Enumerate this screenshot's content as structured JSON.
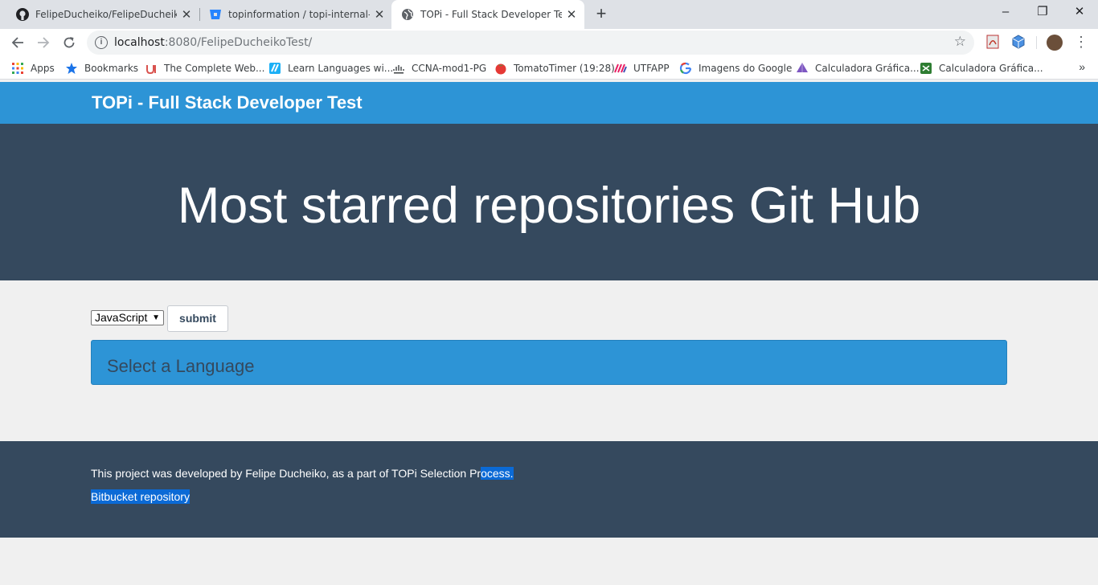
{
  "browser": {
    "tabs": [
      {
        "title": "FelipeDucheiko/FelipeDucheikoT",
        "favicon": "github-icon",
        "active": false
      },
      {
        "title": "topinformation / topi-internal-ful",
        "favicon": "bitbucket-icon",
        "active": false
      },
      {
        "title": "TOPi - Full Stack Developer Test",
        "favicon": "globe-icon",
        "active": true
      }
    ],
    "new_tab": "+",
    "window_controls": {
      "minimize": "–",
      "maximize": "❐",
      "close": "✕"
    },
    "url": {
      "host": "localhost",
      "rest": ":8080/FelipeDucheikoTest/"
    },
    "bookmarks": [
      {
        "label": "Apps",
        "icon": "apps-grid-icon"
      },
      {
        "label": "Bookmarks",
        "icon": "star-icon"
      },
      {
        "label": "The Complete Web...",
        "icon": "udemy-icon"
      },
      {
        "label": "Learn Languages wi...",
        "icon": "duolingo-icon"
      },
      {
        "label": "CCNA-mod1-PG",
        "icon": "cisco-icon"
      },
      {
        "label": "TomatoTimer (19:28)",
        "icon": "tomato-icon"
      },
      {
        "label": "UTFAPP",
        "icon": "utfapp-icon"
      },
      {
        "label": "Imagens do Google",
        "icon": "google-icon"
      },
      {
        "label": "Calculadora Gráfica...",
        "icon": "geogebra-icon"
      },
      {
        "label": "Calculadora Gráfica...",
        "icon": "calculator-icon"
      }
    ],
    "bookmarks_more": "»"
  },
  "page": {
    "brand": "TOPi - Full Stack Developer Test",
    "hero_title": "Most starred repositories Git Hub",
    "language_select": {
      "selected": "JavaScript"
    },
    "submit_label": "submit",
    "result_text": "Select a Language",
    "footer": {
      "text_before_highlight": "This project was developed by Felipe Ducheiko, as a part of TOPi Selection Pr",
      "text_highlighted": "ocess.",
      "link": "Bitbucket repository"
    }
  },
  "colors": {
    "navbar": "#2d94d6",
    "hero": "#35495e",
    "footer": "#35495e",
    "selection": "#0b6ad6"
  }
}
